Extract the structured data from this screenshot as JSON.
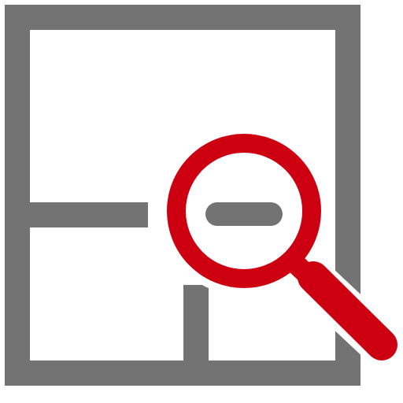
{
  "icon": {
    "name": "floor-plan-zoom-icon",
    "colors": {
      "background": "#ffffff",
      "plan_stroke": "#737373",
      "magnifier": "#cc0010",
      "halo": "#ffffff"
    }
  }
}
